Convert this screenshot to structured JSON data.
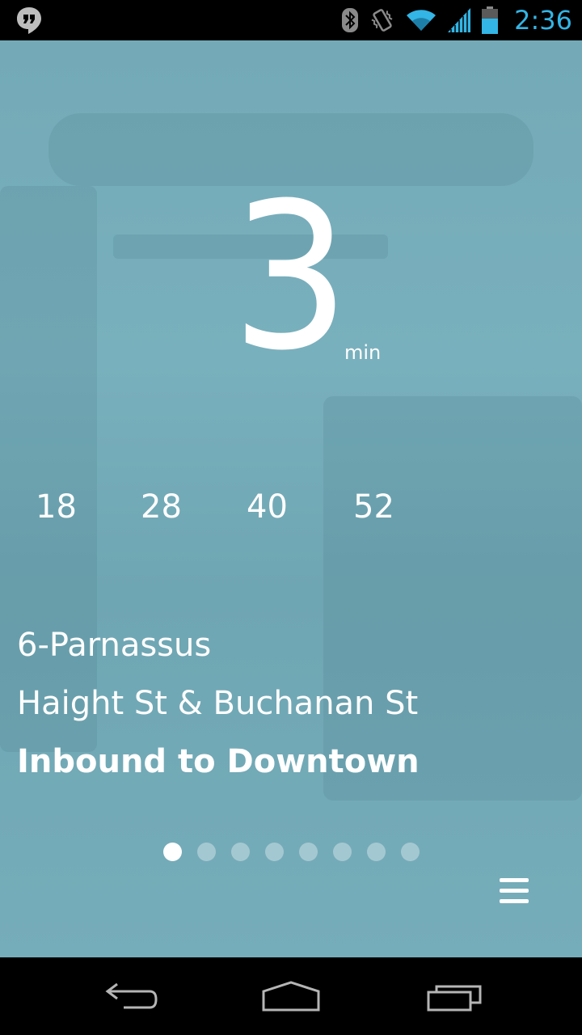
{
  "status_bar": {
    "time": "2:36",
    "icons": [
      "hangouts-icon",
      "bluetooth-icon",
      "vibrate-icon",
      "wifi-icon",
      "signal-icon",
      "battery-icon"
    ],
    "time_color": "#33b5e5"
  },
  "arrival": {
    "minutes": "3",
    "unit": "min",
    "next_times": [
      "18",
      "28",
      "40",
      "52"
    ]
  },
  "route": {
    "name": "6-Parnassus",
    "stop": "Haight St & Buchanan St",
    "direction": "Inbound to Downtown"
  },
  "pager": {
    "total_pages": 8,
    "active_index": 0
  },
  "actions": {
    "menu_icon": "menu-icon"
  },
  "navigation": {
    "icons": [
      "back-icon",
      "home-icon",
      "recents-icon"
    ]
  },
  "colors": {
    "background": "#74aab7",
    "text": "#ffffff"
  }
}
